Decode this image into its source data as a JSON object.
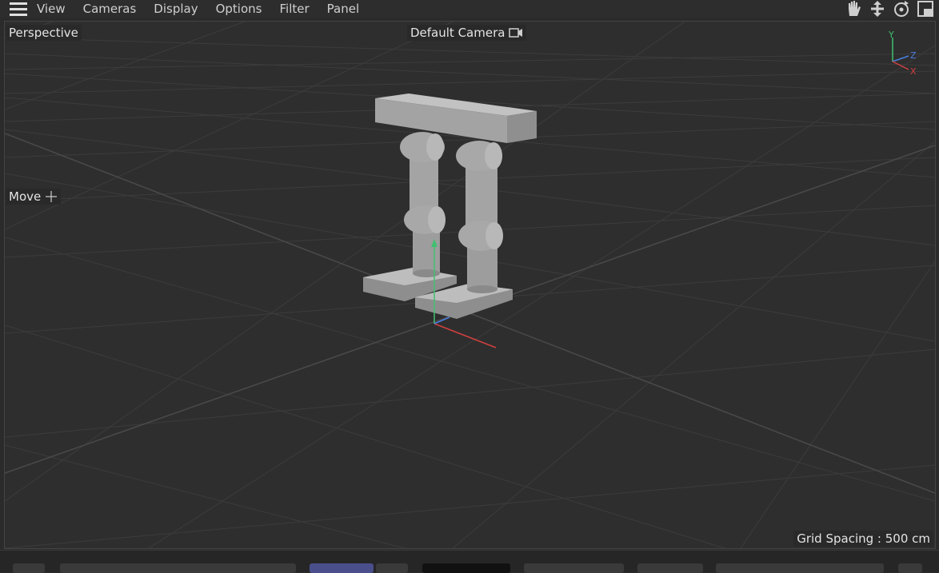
{
  "menu": {
    "items": [
      "View",
      "Cameras",
      "Display",
      "Options",
      "Filter",
      "Panel"
    ]
  },
  "nav_icons": [
    "hand-pan-icon",
    "move-arrows-icon",
    "orbit-icon",
    "maximize-panel-icon"
  ],
  "viewport": {
    "projection_label": "Perspective",
    "camera_label": "Default Camera",
    "tool_label": "Move",
    "grid_spacing": "Grid Spacing : 500 cm",
    "axis_labels": {
      "y": "Y",
      "z": "Z",
      "x": "X"
    }
  },
  "colors": {
    "axis_x": "#d04040",
    "axis_y": "#40c070",
    "axis_z": "#4a7fe0",
    "model": "#a9a9a9"
  }
}
